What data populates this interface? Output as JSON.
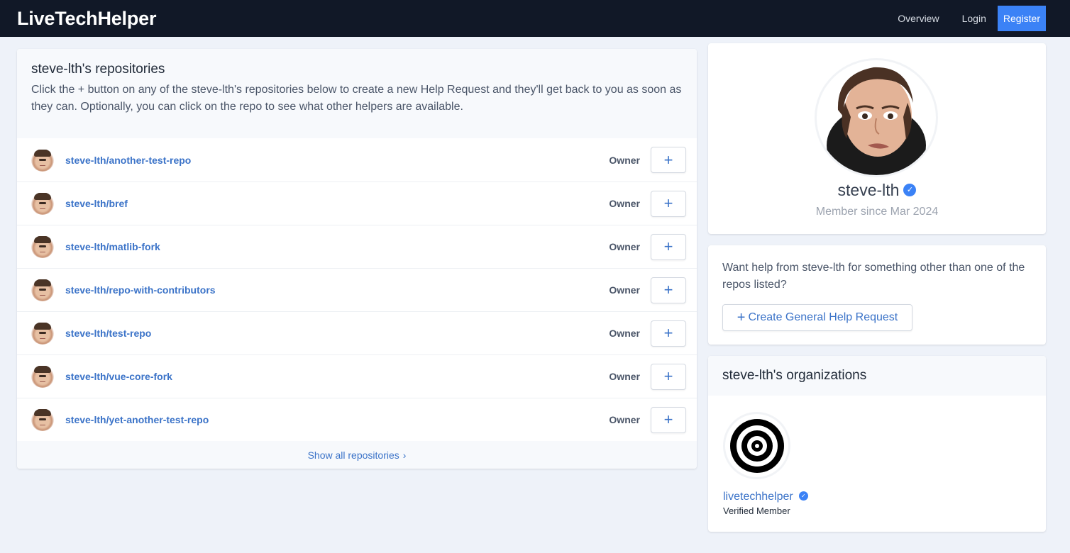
{
  "navbar": {
    "brand": "LiveTechHelper",
    "links": {
      "overview": "Overview",
      "login": "Login",
      "register": "Register"
    }
  },
  "repositories": {
    "title": "steve-lth's repositories",
    "description": "Click the + button on any of the steve-lth's repositories below to create a new Help Request and they'll get back to you as soon as they can. Optionally, you can click on the repo to see what other helpers are available.",
    "rows": [
      {
        "name": "steve-lth/another-test-repo",
        "role": "Owner"
      },
      {
        "name": "steve-lth/bref",
        "role": "Owner"
      },
      {
        "name": "steve-lth/matlib-fork",
        "role": "Owner"
      },
      {
        "name": "steve-lth/repo-with-contributors",
        "role": "Owner"
      },
      {
        "name": "steve-lth/test-repo",
        "role": "Owner"
      },
      {
        "name": "steve-lth/vue-core-fork",
        "role": "Owner"
      },
      {
        "name": "steve-lth/yet-another-test-repo",
        "role": "Owner"
      }
    ],
    "show_all": "Show all repositories",
    "plus_glyph": "+"
  },
  "profile": {
    "username": "steve-lth",
    "member_since": "Member since Mar 2024"
  },
  "help": {
    "text": "Want help from steve-lth for something other than one of the repos listed?",
    "button_label": "Create General Help Request"
  },
  "organizations": {
    "title": "steve-lth's organizations",
    "items": [
      {
        "name": "livetechhelper",
        "status": "Verified Member"
      }
    ]
  },
  "icons": {
    "verified": "check-badge-icon",
    "chevron": "chevron-right-icon",
    "plus": "plus-icon"
  },
  "colors": {
    "navbar_bg": "#111827",
    "accent": "#3b82f6",
    "link": "#3b73c8",
    "page_bg": "#eef2f9"
  }
}
